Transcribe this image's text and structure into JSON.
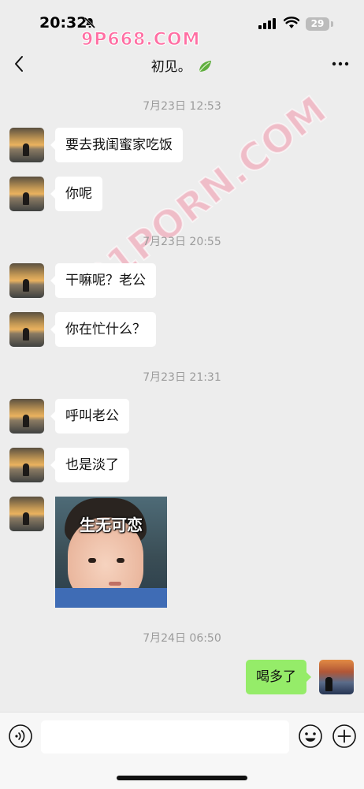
{
  "status_bar": {
    "time": "20:32",
    "battery": "29"
  },
  "watermarks": {
    "top": "9P668.COM",
    "diagonal": "91PORN.COM"
  },
  "header": {
    "title": "初见。"
  },
  "messages": [
    {
      "type": "timestamp",
      "text": "7月23日 12:53"
    },
    {
      "type": "text",
      "text": "要去我闺蜜家吃饭"
    },
    {
      "type": "text",
      "text": "你呢"
    },
    {
      "type": "timestamp",
      "text": "7月23日 20:55"
    },
    {
      "type": "text",
      "text": "干嘛呢？老公"
    },
    {
      "type": "text",
      "text": "你在忙什么？"
    },
    {
      "type": "timestamp",
      "text": "7月23日 21:31"
    },
    {
      "type": "text",
      "text": "呼叫老公"
    },
    {
      "type": "text",
      "text": "也是淡了"
    },
    {
      "type": "sticker",
      "caption": "生无可恋"
    },
    {
      "type": "timestamp",
      "text": "7月24日 06:50"
    },
    {
      "type": "text_self",
      "text": "喝多了"
    }
  ],
  "input": {
    "value": "",
    "placeholder": ""
  },
  "colors": {
    "background": "#ededed",
    "self_bubble": "#95ec69",
    "other_bubble": "#ffffff"
  }
}
